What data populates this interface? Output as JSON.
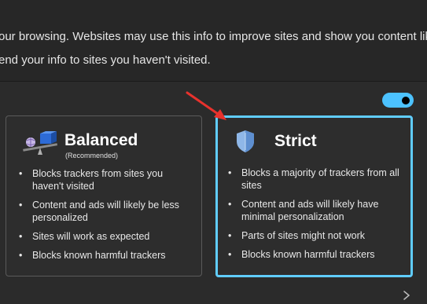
{
  "intro": {
    "line1": "our browsing. Websites may use this info to improve sites and show you content like",
    "line2": "end your info to sites you haven't visited."
  },
  "toggle": {
    "state": "on"
  },
  "cards": {
    "balanced": {
      "title": "Balanced",
      "subtitle": "(Recommended)",
      "icon": "balance-scale-icon",
      "bullets": [
        "Blocks trackers from sites you haven't visited",
        "Content and ads will likely be less personalized",
        "Sites will work as expected",
        "Blocks known harmful trackers"
      ]
    },
    "strict": {
      "title": "Strict",
      "icon": "shield-icon",
      "selected": true,
      "bullets": [
        "Blocks a majority of trackers from all sites",
        "Content and ads will likely have minimal personalization",
        "Parts of sites might not work",
        "Blocks known harmful trackers"
      ]
    }
  },
  "colors": {
    "accent": "#60cdff",
    "toggle_on": "#4cc2ff",
    "annotation_arrow": "#e8322d"
  }
}
